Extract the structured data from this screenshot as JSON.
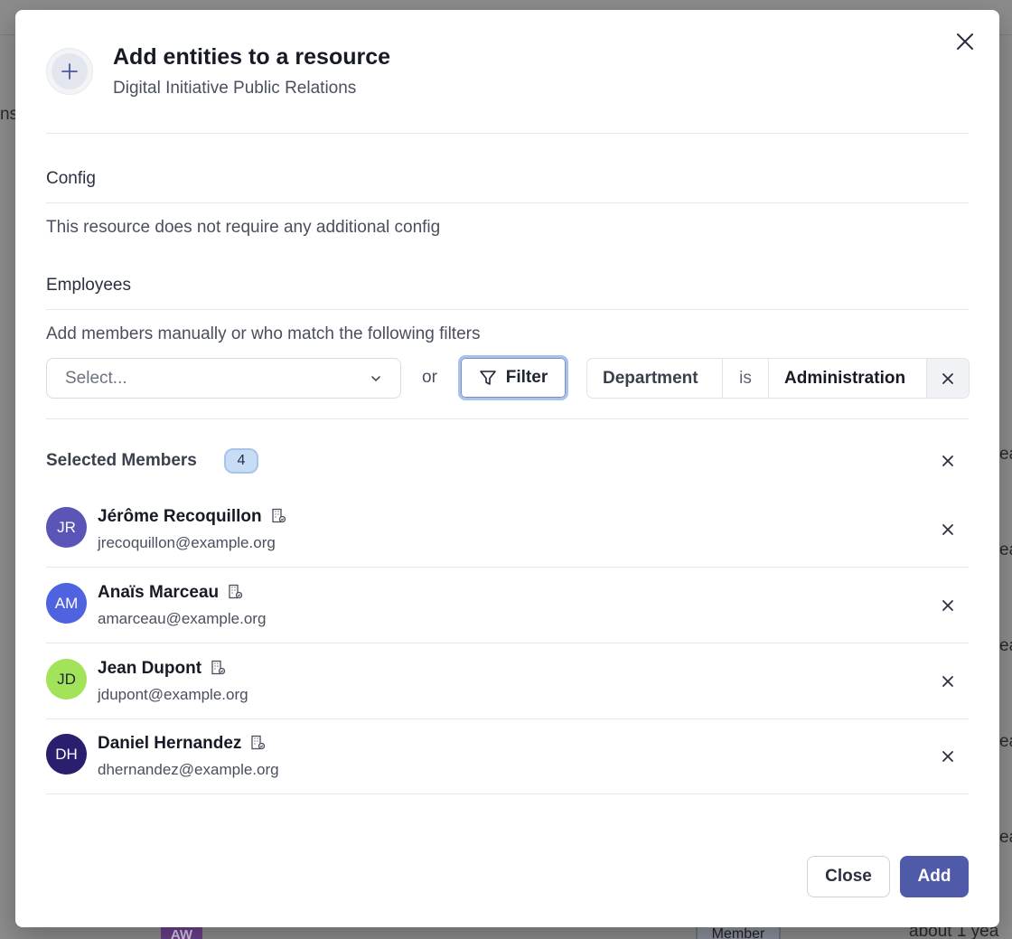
{
  "background": {
    "left_fragment": "ns",
    "right_fragments": [
      "ea",
      "ea",
      "ea",
      "ea",
      "ea"
    ],
    "avatar_initials": "AW",
    "badge": "Member",
    "time_text": "about 1 yea"
  },
  "modal": {
    "title": "Add entities to a resource",
    "subtitle": "Digital Initiative Public Relations",
    "config": {
      "heading": "Config",
      "text": "This resource does not require any additional config"
    },
    "employees": {
      "heading": "Employees",
      "helper": "Add members manually or who match the following filters",
      "select_placeholder": "Select...",
      "or_label": "or",
      "filter_button": "Filter",
      "filter_chip": {
        "field": "Department",
        "operator": "is",
        "value": "Administration"
      }
    },
    "selected": {
      "label": "Selected Members",
      "count": "4",
      "members": [
        {
          "initials": "JR",
          "name": "Jérôme Recoquillon",
          "email": "jrecoquillon@example.org",
          "color": "#5b55b7"
        },
        {
          "initials": "AM",
          "name": "Anaïs Marceau",
          "email": "amarceau@example.org",
          "color": "#4f63e0"
        },
        {
          "initials": "JD",
          "name": "Jean Dupont",
          "email": "jdupont@example.org",
          "color": "#a3e35a"
        },
        {
          "initials": "DH",
          "name": "Daniel Hernandez",
          "email": "dhernandez@example.org",
          "color": "#2a1f6e"
        }
      ]
    },
    "footer": {
      "close_label": "Close",
      "add_label": "Add"
    }
  },
  "colors": {
    "primary": "#4f5aa8",
    "filter_focus": "#a9c3ec",
    "badge_bg": "#c9dcf6"
  }
}
